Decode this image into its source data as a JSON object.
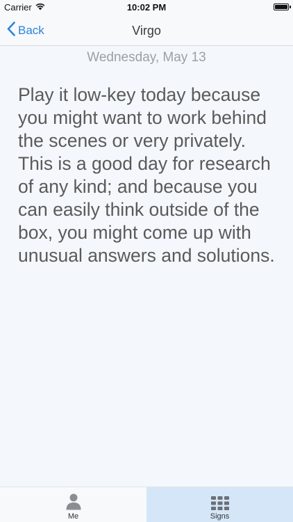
{
  "status_bar": {
    "carrier": "Carrier",
    "time": "10:02 PM"
  },
  "nav": {
    "back_label": "Back",
    "title": "Virgo"
  },
  "date": "Wednesday, May 13",
  "horoscope_text": "Play it low-key today because you might want to work behind the scenes or very privately. This is a good day for research of any kind; and because you can easily think outside of the box, you might come up with unusual answers and solutions.",
  "tab_bar": {
    "tabs": [
      {
        "label": "Me",
        "icon": "person-icon",
        "selected": false
      },
      {
        "label": "Signs",
        "icon": "grid-icon",
        "selected": true
      }
    ]
  },
  "colors": {
    "accent": "#2b84d8",
    "background": "#f4f8fc",
    "selected_tab": "#d5e6f8"
  }
}
